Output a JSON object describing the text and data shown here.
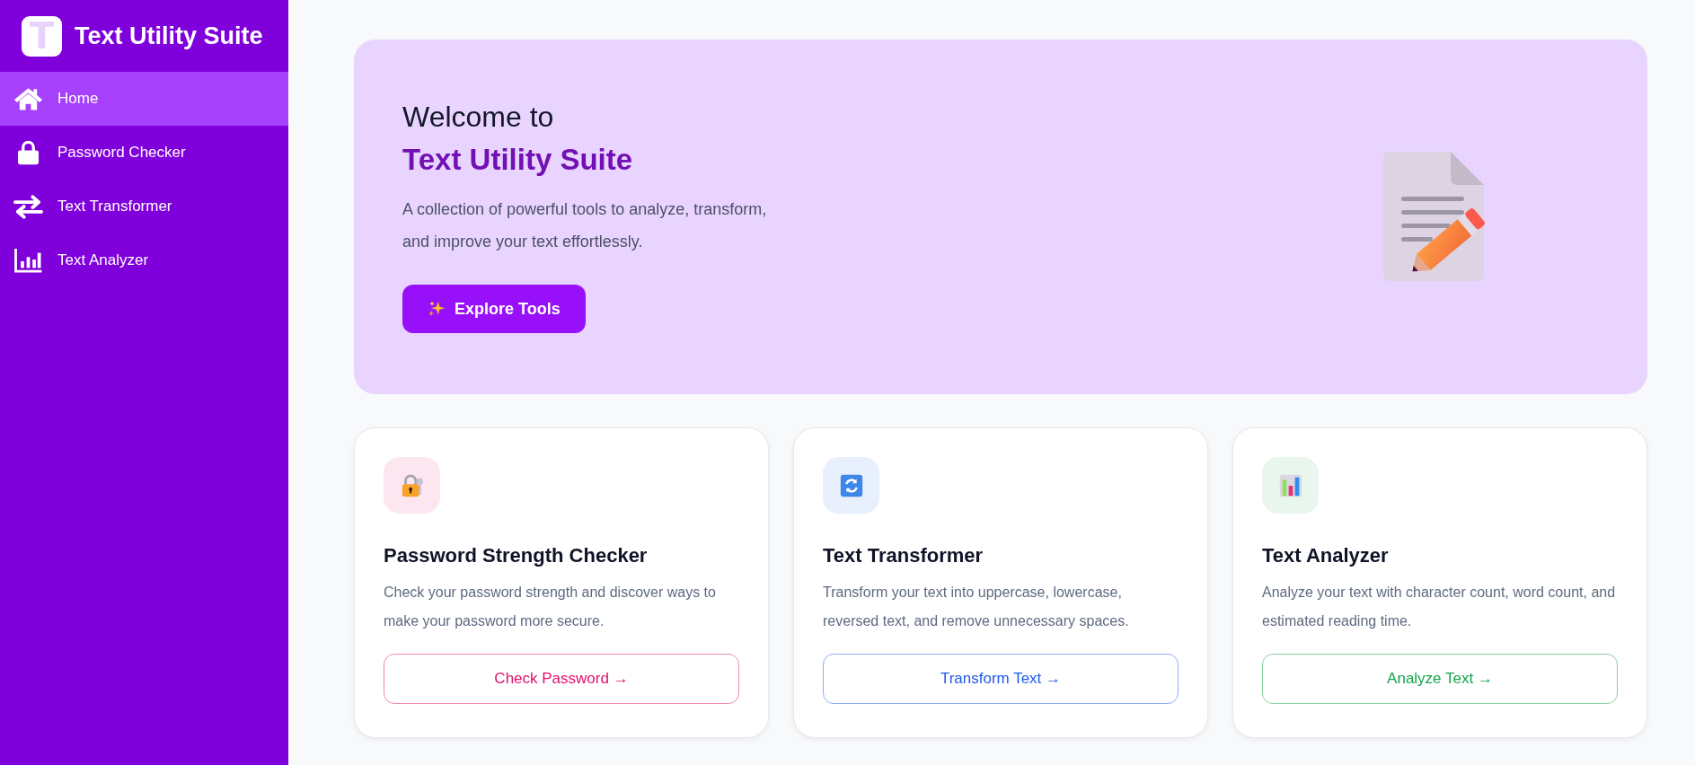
{
  "sidebar": {
    "logo_letter": "T",
    "title": "Text Utility Suite",
    "items": [
      {
        "label": "Home",
        "selected": true
      },
      {
        "label": "Password Checker",
        "selected": false
      },
      {
        "label": "Text Transformer",
        "selected": false
      },
      {
        "label": "Text Analyzer",
        "selected": false
      }
    ]
  },
  "hero": {
    "greeting": "Welcome to",
    "title": "Text Utility Suite",
    "description": "A collection of powerful tools to analyze, transform, and improve your text effortlessly.",
    "button": "Explore Tools"
  },
  "cards": [
    {
      "title": "Password Strength Checker",
      "description": "Check your password strength and discover ways to make your password more secure.",
      "button": "Check Password →",
      "color": "#e0116b"
    },
    {
      "title": "Text Transformer",
      "description": "Transform your text into uppercase, lowercase, reversed text, and remove unnecessary spaces.",
      "button": "Transform Text →",
      "color": "#1d5ae8"
    },
    {
      "title": "Text Analyzer",
      "description": "Analyze your text with character count, word count, and estimated reading time.",
      "button": "Analyze Text →",
      "color": "#15a34a"
    }
  ]
}
